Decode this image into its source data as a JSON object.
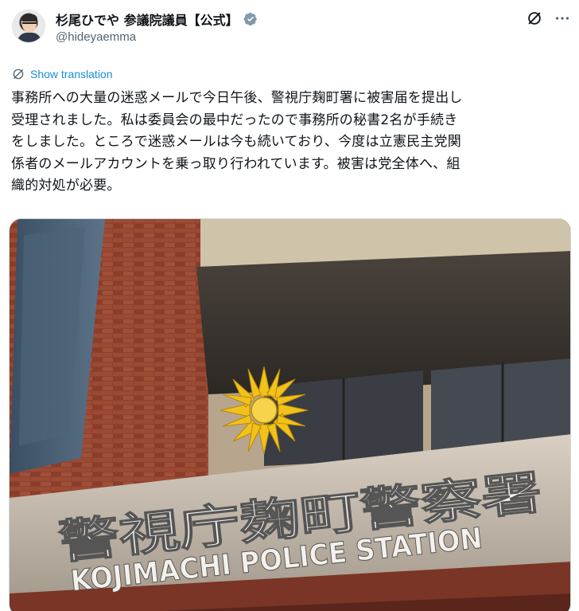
{
  "author": {
    "display_name": "杉尾ひでや 参議院議員【公式】",
    "handle": "@hideyaemma",
    "verified": true
  },
  "actions": {
    "grok_icon": "grok-slash-icon",
    "more_icon": "more-horizontal-icon"
  },
  "translate": {
    "label": "Show translation",
    "icon": "translate-icon"
  },
  "post": {
    "lines": [
      "事務所への大量の迷惑メールで今日午後、警視庁麹町署に被害届を提出し",
      "受理されました。私は委員会の最中だったので事務所の秘書2名が手続き",
      "をしました。ところで迷惑メールは今も続いており、今度は立憲民主党関",
      "係者のメールアカウントを乗っ取り行われています。被害は党全体へ、組",
      "織的対処が必要。"
    ]
  },
  "media": {
    "sign_japanese": "警視庁麹町警察署",
    "sign_english": "KOJIMACHI POLICE STATION",
    "colors": {
      "brick": "#8a3f2c",
      "emblem_gold": "#f2c21a",
      "sign_panel": "#c8bfb2"
    }
  },
  "colors": {
    "link_blue": "#1a8cd8",
    "text": "#0f1419",
    "secondary": "#536471",
    "verified_gray": "#829aab"
  }
}
